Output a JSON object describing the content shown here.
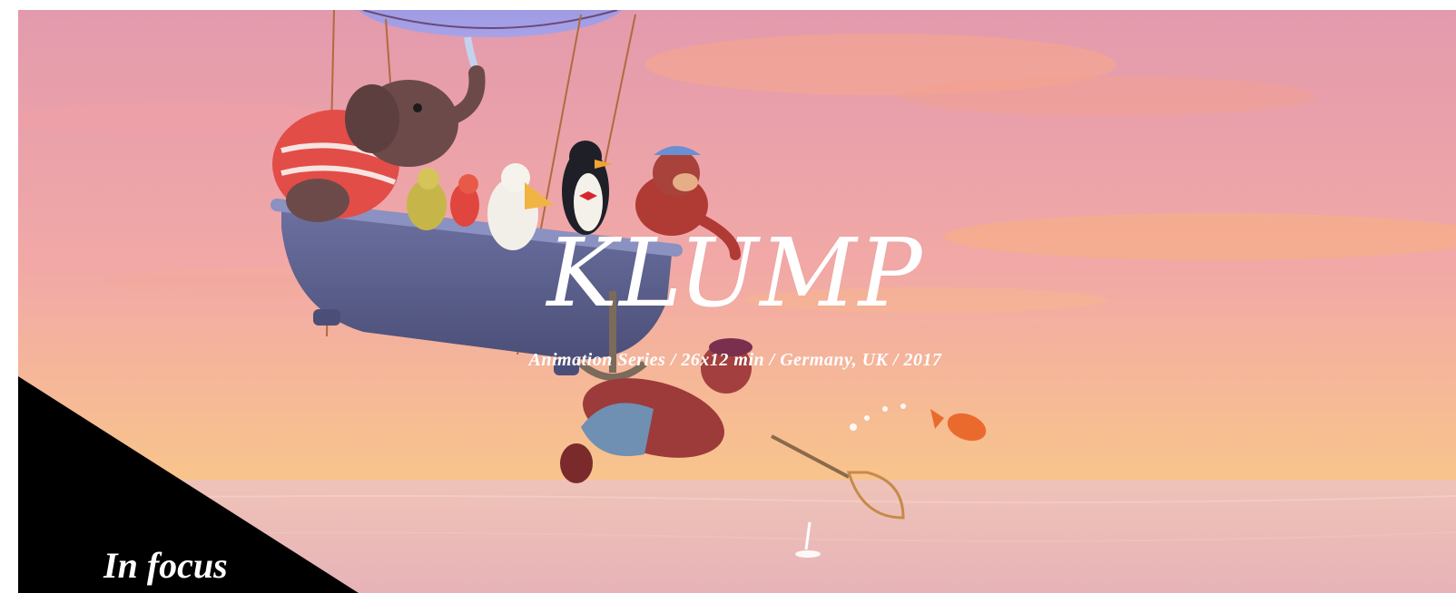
{
  "featured": {
    "title": "KLUMP",
    "meta": "Animation Series / 26x12 min / Germany, UK / 2017"
  },
  "section": {
    "label": "In focus"
  },
  "colors": {
    "sky_top": "#e7a0b0",
    "sky_mid": "#f0a9a4",
    "sky_horizon": "#f7c78e",
    "sea": "#eec2bc",
    "corner": "#000000",
    "text": "#ffffff"
  }
}
